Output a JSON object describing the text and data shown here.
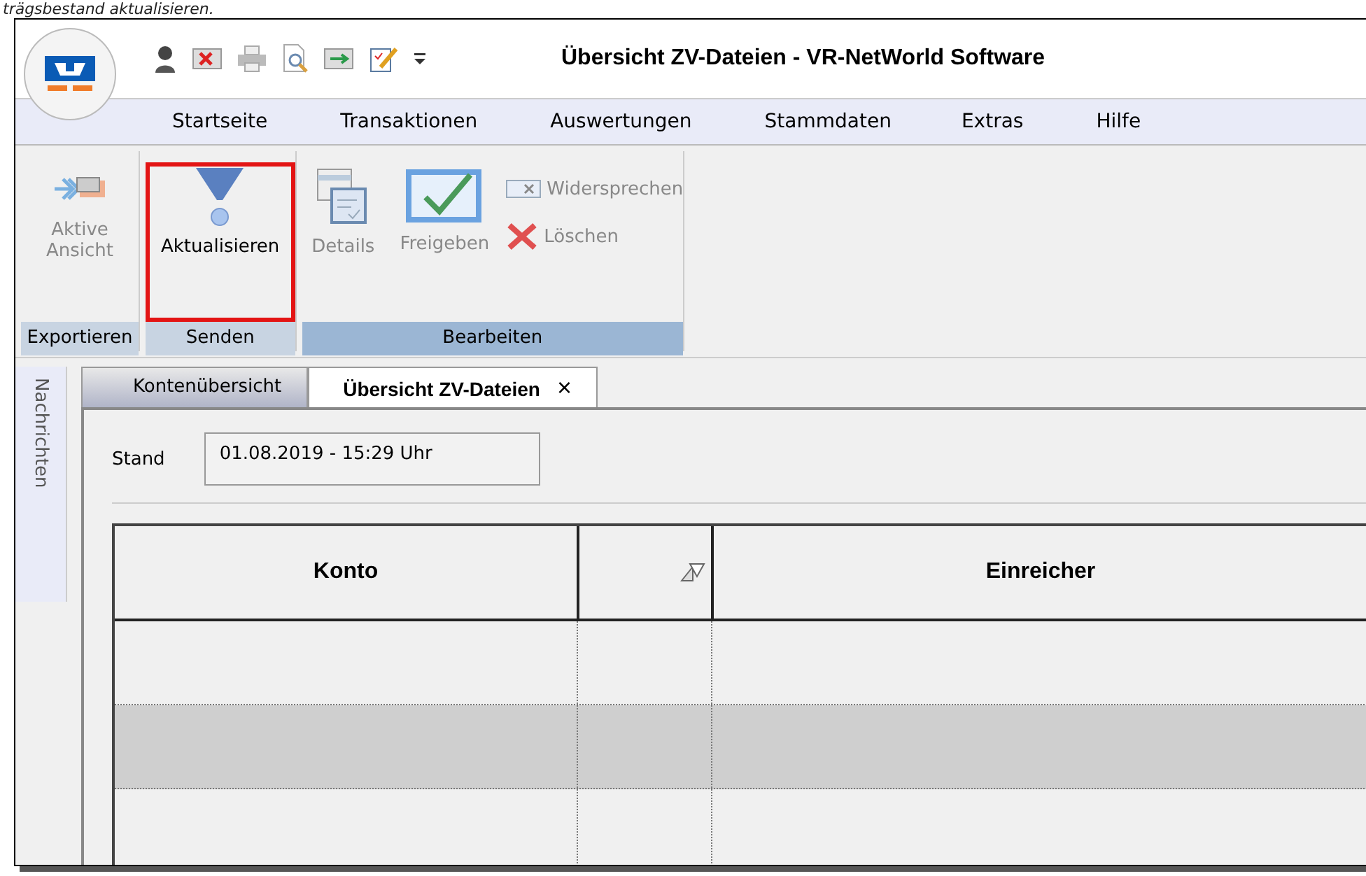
{
  "caption": "trägsbestand aktualisieren.",
  "window": {
    "title": "Übersicht ZV-Dateien - VR-NetWorld Software"
  },
  "menu": [
    {
      "label": "Startseite"
    },
    {
      "label": "Transaktionen"
    },
    {
      "label": "Auswertungen"
    },
    {
      "label": "Stammdaten"
    },
    {
      "label": "Extras"
    },
    {
      "label": "Hilfe"
    }
  ],
  "ribbon_groups": [
    {
      "label": "Exportieren",
      "items": [
        {
          "kind": "large",
          "label": "Aktive Ansicht",
          "disabled": true,
          "highlighted": false
        }
      ]
    },
    {
      "label": "Senden",
      "items": [
        {
          "kind": "large",
          "label": "Aktualisieren",
          "disabled": false,
          "highlighted": true
        }
      ]
    },
    {
      "label": "Bearbeiten",
      "items": [
        {
          "kind": "large",
          "label": "Details",
          "disabled": true,
          "highlighted": false
        },
        {
          "kind": "large",
          "label": "Freigeben",
          "disabled": true,
          "highlighted": false
        },
        {
          "kind": "small",
          "label": "Widersprechen",
          "disabled": true,
          "highlighted": false
        },
        {
          "kind": "small",
          "label": "Löschen",
          "disabled": true,
          "highlighted": false
        }
      ]
    }
  ],
  "side_panel": {
    "label": "Nachrichten"
  },
  "doc_tabs": [
    {
      "label": "Kontenübersicht",
      "selected": false
    },
    {
      "label": "Übersicht ZV-Dateien",
      "selected": true,
      "close": "×"
    }
  ],
  "stand": {
    "label": "Stand",
    "value": "01.08.2019 - 15:29 Uhr"
  },
  "table": {
    "columns": [
      {
        "kind": "text",
        "label": "Konto"
      },
      {
        "kind": "sort"
      },
      {
        "kind": "text",
        "label": "Einreicher"
      }
    ],
    "rows": [
      {
        "selected": false
      },
      {
        "selected": true
      },
      {
        "selected": false
      }
    ]
  }
}
